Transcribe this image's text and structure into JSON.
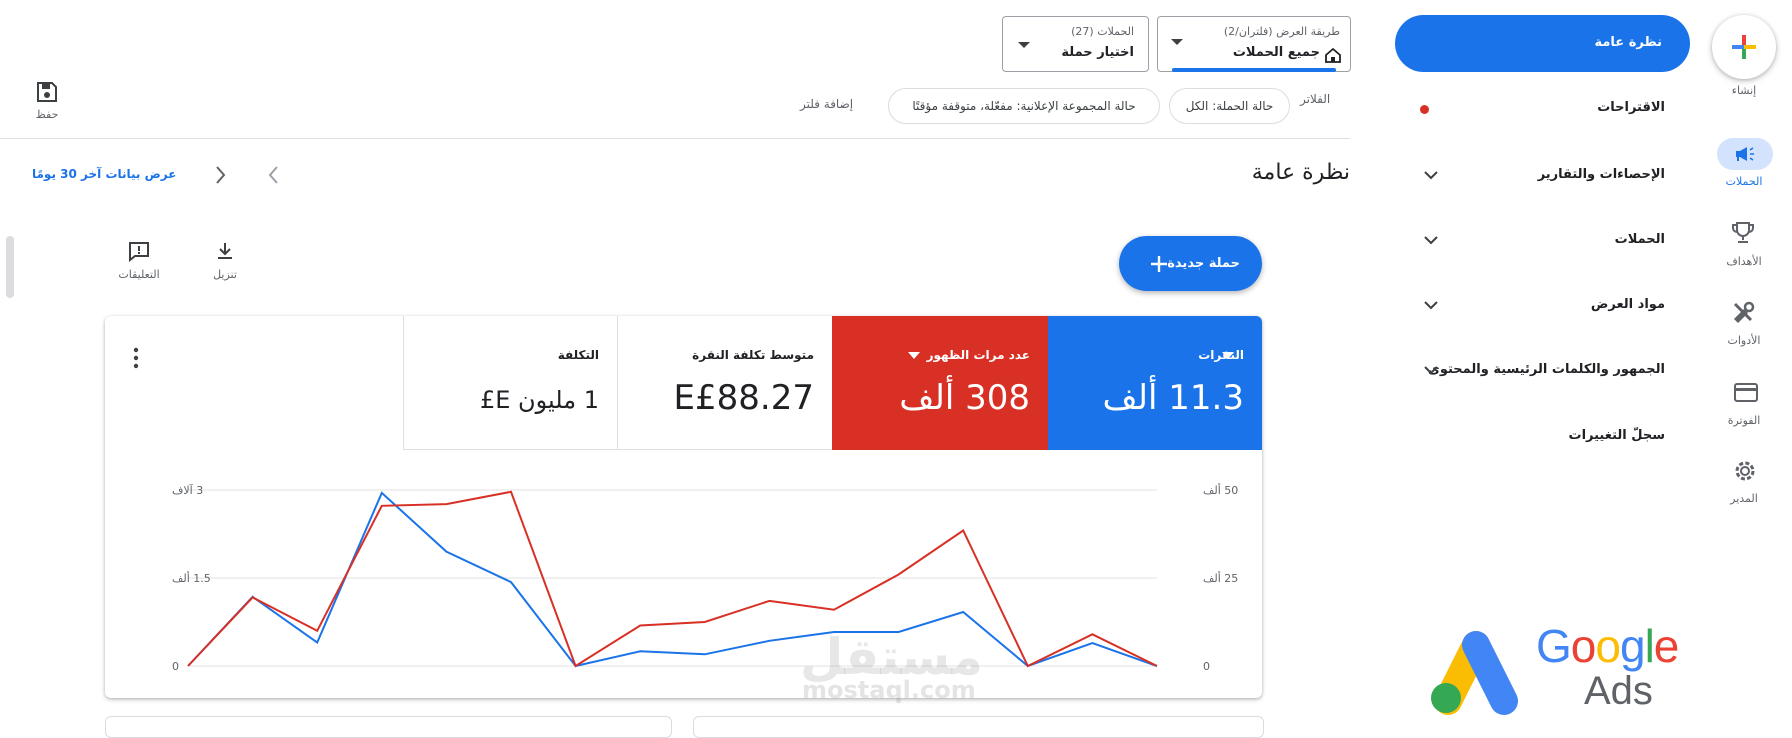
{
  "rail": {
    "create_label": "إنشاء",
    "items": [
      {
        "label": "الحملات",
        "icon": "megaphone-icon",
        "active": true
      },
      {
        "label": "الأهداف",
        "icon": "trophy-icon"
      },
      {
        "label": "الأدوات",
        "icon": "tools-icon"
      },
      {
        "label": "الفوترة",
        "icon": "credit-card-icon"
      },
      {
        "label": "المدير",
        "icon": "gear-icon"
      }
    ]
  },
  "nav": {
    "active": "نظرة عامة",
    "items": [
      {
        "label": "الاقتراحات",
        "has_dot": true
      },
      {
        "label": "الإحصاءات والتقارير",
        "expandable": true
      },
      {
        "label": "الحملات",
        "expandable": true
      },
      {
        "label": "مواد العرض",
        "expandable": true
      },
      {
        "label": "الجمهور والكلمات الرئيسية والمحتوى",
        "expandable": true
      },
      {
        "label": "سجلّ التغييرات"
      }
    ]
  },
  "topbar": {
    "view_mode_small": "طريقة العرض (فلتران/2)",
    "view_mode_value": "جميع الحملات",
    "campaigns_small": "الحملات (27)",
    "campaigns_value": "اختيار حملة",
    "save_label": "حفظ"
  },
  "filters": {
    "label": "الفلاتر",
    "chips": [
      "حالة الحملة: الكل",
      "حالة المجموعة الإعلانية: مفعّلة، متوقفة مؤقتًا"
    ],
    "add": "إضافة فلتر"
  },
  "overview": {
    "title": "نظرة عامة",
    "date_range": "عرض بيانات آخر 30 يومًا",
    "download": "تنزيل",
    "feedback": "التعليقات",
    "new_campaign": "حملة جديدة"
  },
  "metrics": [
    {
      "label": "النقرات",
      "value": "11.3 ألف",
      "color": "#1a73e8",
      "dropdown": true
    },
    {
      "label": "عدد مرات الظهور",
      "value": "308 ألف",
      "color": "#d93025",
      "dropdown": true
    },
    {
      "label": "متوسط تكلفة النقرة",
      "value": "E£88.27"
    },
    {
      "label": "التكلفة",
      "value": "1 مليون E£"
    }
  ],
  "colors": {
    "accent": "#1a73e8",
    "red": "#d93025"
  },
  "chart_data": {
    "type": "line",
    "left_axis_ticks": [
      "3 آلاف",
      "1.5 ألف",
      "0"
    ],
    "right_axis_ticks": [
      "50 ألف",
      "25 ألف",
      "0"
    ],
    "left_axis_range": [
      0,
      3000
    ],
    "right_axis_range": [
      0,
      50000
    ],
    "grid": true,
    "x": [
      1,
      2,
      3,
      4,
      5,
      6,
      7,
      8,
      9,
      10,
      11,
      12,
      13,
      14,
      15,
      16
    ],
    "series": [
      {
        "name": "النقرات",
        "color": "#1a73e8",
        "axis": "left",
        "values": [
          0,
          1180,
          400,
          2950,
          1950,
          1430,
          0,
          250,
          200,
          430,
          580,
          580,
          920,
          0,
          390,
          0
        ]
      },
      {
        "name": "عدد مرات الظهور",
        "color": "#d93025",
        "axis": "right",
        "values": [
          0,
          19500,
          10000,
          45500,
          46000,
          49500,
          0,
          11500,
          12500,
          18500,
          16000,
          26000,
          38500,
          0,
          9000,
          0
        ]
      }
    ]
  },
  "watermark": {
    "arabic": "مستقل",
    "latin": "mostaql.com"
  },
  "ads_logo": {
    "line1": "Google",
    "line2": "Ads"
  }
}
